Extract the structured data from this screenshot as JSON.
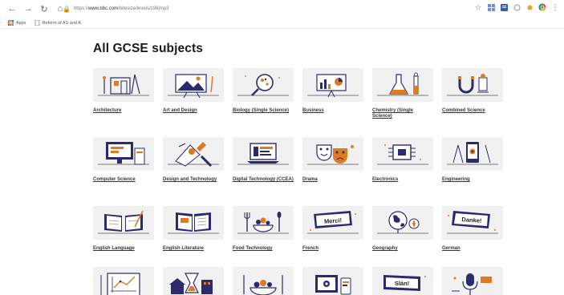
{
  "browser": {
    "url_prefix": "https://",
    "url_host": "www.bbc.com",
    "url_path": "/bitesize/levels/z98jmp3",
    "bookmarks": [
      {
        "label": "Apps"
      },
      {
        "label": "Reform of AS and A"
      }
    ]
  },
  "page": {
    "title": "All GCSE subjects"
  },
  "subjects": [
    {
      "label": "Architecture",
      "icon": "architecture-icon"
    },
    {
      "label": "Art and Design",
      "icon": "art-easel-icon"
    },
    {
      "label": "Biology (Single Science)",
      "icon": "microscope-icon"
    },
    {
      "label": "Business",
      "icon": "presentation-board-icon"
    },
    {
      "label": "Chemistry (Single Science)",
      "icon": "flask-icon"
    },
    {
      "label": "Combined Science",
      "icon": "magnet-icon"
    },
    {
      "label": "Computer Science",
      "icon": "computer-icon"
    },
    {
      "label": "Design and Technology",
      "icon": "design-tools-icon"
    },
    {
      "label": "Digital Technology (CCEA)",
      "icon": "laptop-icon"
    },
    {
      "label": "Drama",
      "icon": "theatre-masks-icon"
    },
    {
      "label": "Electronics",
      "icon": "chip-icon"
    },
    {
      "label": "Engineering",
      "icon": "tablet-compass-icon"
    },
    {
      "label": "English Language",
      "icon": "open-book-pen-icon"
    },
    {
      "label": "English Literature",
      "icon": "open-book-icon"
    },
    {
      "label": "Food Technology",
      "icon": "cutlery-bowl-icon"
    },
    {
      "label": "French",
      "icon": "speech-sign-icon",
      "sign": "Merci!"
    },
    {
      "label": "Geography",
      "icon": "globe-compass-icon"
    },
    {
      "label": "German",
      "icon": "speech-sign-icon",
      "sign": "Danke!"
    },
    {
      "label": "",
      "icon": "graph-board-icon"
    },
    {
      "label": "",
      "icon": "hourglass-buildings-icon"
    },
    {
      "label": "",
      "icon": "food-bowl-icon"
    },
    {
      "label": "",
      "icon": "devices-icon"
    },
    {
      "label": "",
      "icon": "speech-sign-icon",
      "sign": "Slán!"
    },
    {
      "label": "",
      "icon": "microphone-icon"
    }
  ],
  "colors": {
    "accent": "#e07a1f",
    "navy": "#2b2a6b",
    "tile_bg": "#f1f1f1"
  }
}
